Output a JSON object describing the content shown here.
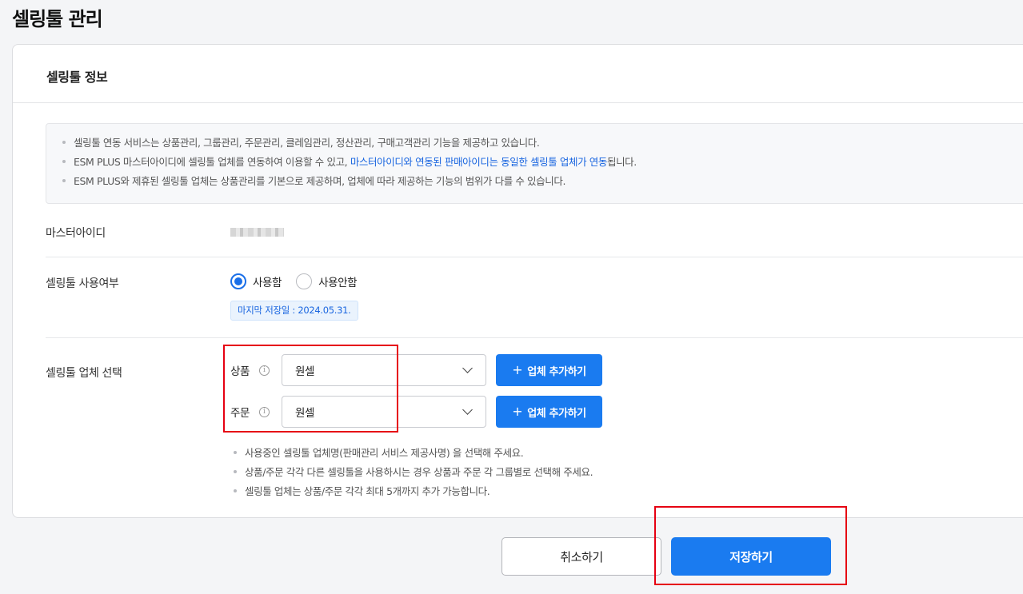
{
  "page": {
    "title": "셀링툴 관리"
  },
  "card": {
    "title": "셀링툴 정보"
  },
  "notice": {
    "line1": "셀링툴 연동 서비스는 상품관리, 그룹관리, 주문관리, 클레임관리, 정산관리, 구매고객관리 기능을 제공하고 있습니다.",
    "line2_a": "ESM PLUS 마스터아이디에 셀링툴 업체를 연동하여 이용할 수 있고, ",
    "line2_b": "마스터아이디와 연동된 판매아이디는 동일한 셀링툴 업체가 연동",
    "line2_c": "됩니다.",
    "line3": "ESM PLUS와 제휴된 셀링툴 업체는 상품관리를 기본으로 제공하며, 업체에 따라 제공하는 기능의 범위가 다를 수 있습니다."
  },
  "master_id": {
    "label": "마스터아이디"
  },
  "usage": {
    "label": "셀링툴 사용여부",
    "options": [
      "사용함",
      "사용안함"
    ],
    "selected": "사용함",
    "last_saved": "마지막 저장일 : 2024.05.31."
  },
  "vendor": {
    "label": "셀링툴 업체 선택",
    "product_label": "상품",
    "product_value": "원셀",
    "order_label": "주문",
    "order_value": "원셀",
    "add_button": "업체 추가하기",
    "info_glyph": "i",
    "hints": [
      "사용중인 셀링툴 업체명(판매관리 서비스 제공사명) 을 선택해 주세요.",
      "상품/주문 각각 다른 셀링툴을 사용하시는 경우 상품과 주문 각 그룹별로 선택해 주세요.",
      "셀링툴 업체는 상품/주문 각각 최대 5개까지 추가 가능합니다."
    ]
  },
  "footer": {
    "cancel": "취소하기",
    "save": "저장하기"
  },
  "colors": {
    "primary": "#1a7bf0",
    "highlight": "#e60012",
    "link": "#1a66e0"
  },
  "icons": {
    "radio_on": "radio-checked-icon",
    "radio_off": "radio-unchecked-icon",
    "chevron": "chevron-down-icon",
    "plus": "plus-icon",
    "info": "info-icon"
  }
}
